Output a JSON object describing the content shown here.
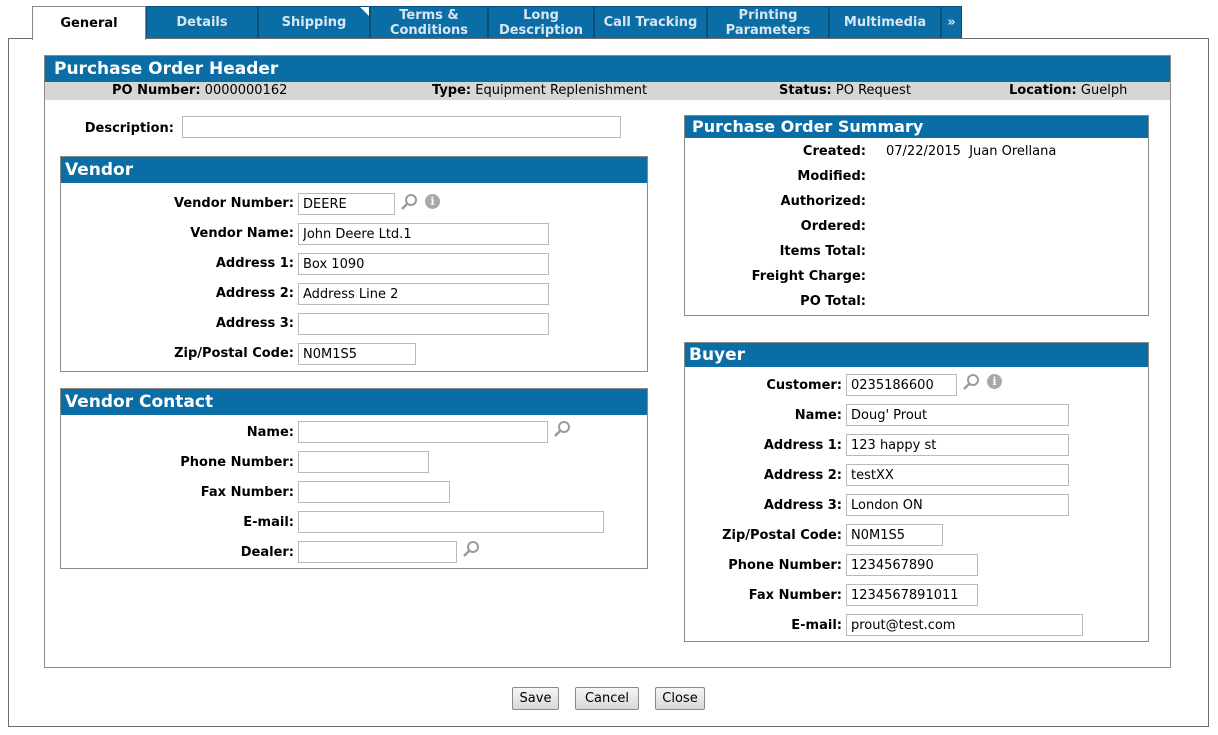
{
  "tabs": [
    {
      "label": "General"
    },
    {
      "label": "Details"
    },
    {
      "label": "Shipping"
    },
    {
      "label": "Terms & Conditions"
    },
    {
      "label": "Long Description"
    },
    {
      "label": "Call Tracking"
    },
    {
      "label": "Printing Parameters"
    },
    {
      "label": "Multimedia"
    },
    {
      "label": "»"
    }
  ],
  "header": {
    "title": "Purchase Order Header",
    "po_number_label": "PO Number:",
    "po_number": "0000000162",
    "type_label": "Type:",
    "type": "Equipment Replenishment",
    "status_label": "Status:",
    "status": "PO Request",
    "location_label": "Location:",
    "location": "Guelph"
  },
  "description": {
    "label": "Description:",
    "value": ""
  },
  "vendor": {
    "title": "Vendor",
    "number_label": "Vendor Number:",
    "number": "DEERE",
    "name_label": "Vendor Name:",
    "name": "John Deere Ltd.1",
    "addr1_label": "Address 1:",
    "addr1": "Box 1090",
    "addr2_label": "Address 2:",
    "addr2": "Address Line 2",
    "addr3_label": "Address 3:",
    "addr3": "",
    "zip_label": "Zip/Postal Code:",
    "zip": "N0M1S5"
  },
  "vendor_contact": {
    "title": "Vendor Contact",
    "name_label": "Name:",
    "name": "",
    "phone_label": "Phone Number:",
    "phone": "",
    "fax_label": "Fax Number:",
    "fax": "",
    "email_label": "E-mail:",
    "email": "",
    "dealer_label": "Dealer:",
    "dealer": ""
  },
  "summary": {
    "title": "Purchase Order Summary",
    "created_label": "Created:",
    "created": "07/22/2015  Juan Orellana",
    "modified_label": "Modified:",
    "authorized_label": "Authorized:",
    "ordered_label": "Ordered:",
    "items_total_label": "Items Total:",
    "freight_label": "Freight Charge:",
    "po_total_label": "PO Total:"
  },
  "buyer": {
    "title": "Buyer",
    "customer_label": "Customer:",
    "customer": "0235186600",
    "name_label": "Name:",
    "name": "Doug' Prout",
    "addr1_label": "Address 1:",
    "addr1": "123 happy st",
    "addr2_label": "Address 2:",
    "addr2": "testXX",
    "addr3_label": "Address 3:",
    "addr3": "London ON",
    "zip_label": "Zip/Postal Code:",
    "zip": "N0M1S5",
    "phone_label": "Phone Number:",
    "phone": "1234567890",
    "fax_label": "Fax Number:",
    "fax": "1234567891011",
    "email_label": "E-mail:",
    "email": "prout@test.com"
  },
  "buttons": {
    "save": "Save",
    "cancel": "Cancel",
    "close": "Close"
  },
  "icons": {
    "search": "magnifier-icon",
    "info": "info-icon"
  },
  "colors": {
    "accent": "#0b6da6",
    "tab_text": "#d8e6f2",
    "info_bar": "#d6d6d6"
  }
}
